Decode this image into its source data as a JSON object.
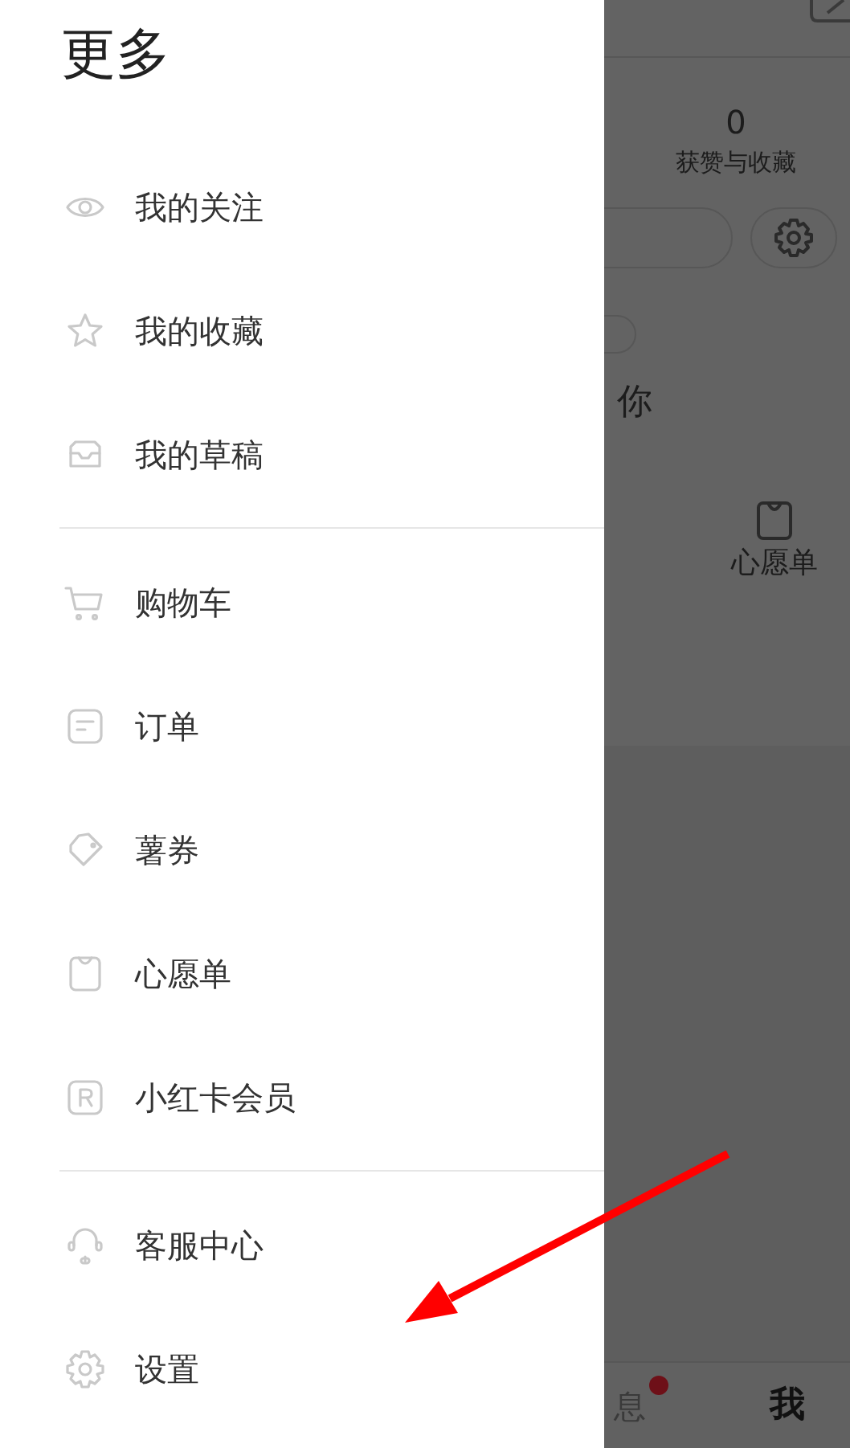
{
  "drawer": {
    "title": "更多",
    "sections": [
      {
        "items": [
          {
            "label": "我的关注"
          },
          {
            "label": "我的收藏"
          },
          {
            "label": "我的草稿"
          }
        ]
      },
      {
        "items": [
          {
            "label": "购物车"
          },
          {
            "label": "订单"
          },
          {
            "label": "薯券"
          },
          {
            "label": "心愿单"
          },
          {
            "label": "小红卡会员"
          }
        ]
      },
      {
        "items": [
          {
            "label": "客服中心"
          },
          {
            "label": "设置"
          }
        ]
      }
    ]
  },
  "background_page": {
    "stat_value": "0",
    "stat_label": "获赞与收藏",
    "partial_text": "你",
    "wishlist_label": "心愿单",
    "tabs": [
      {
        "label": "息",
        "selected": false,
        "unread_dot": true
      },
      {
        "label": "我",
        "selected": true,
        "unread_dot": false
      }
    ]
  }
}
